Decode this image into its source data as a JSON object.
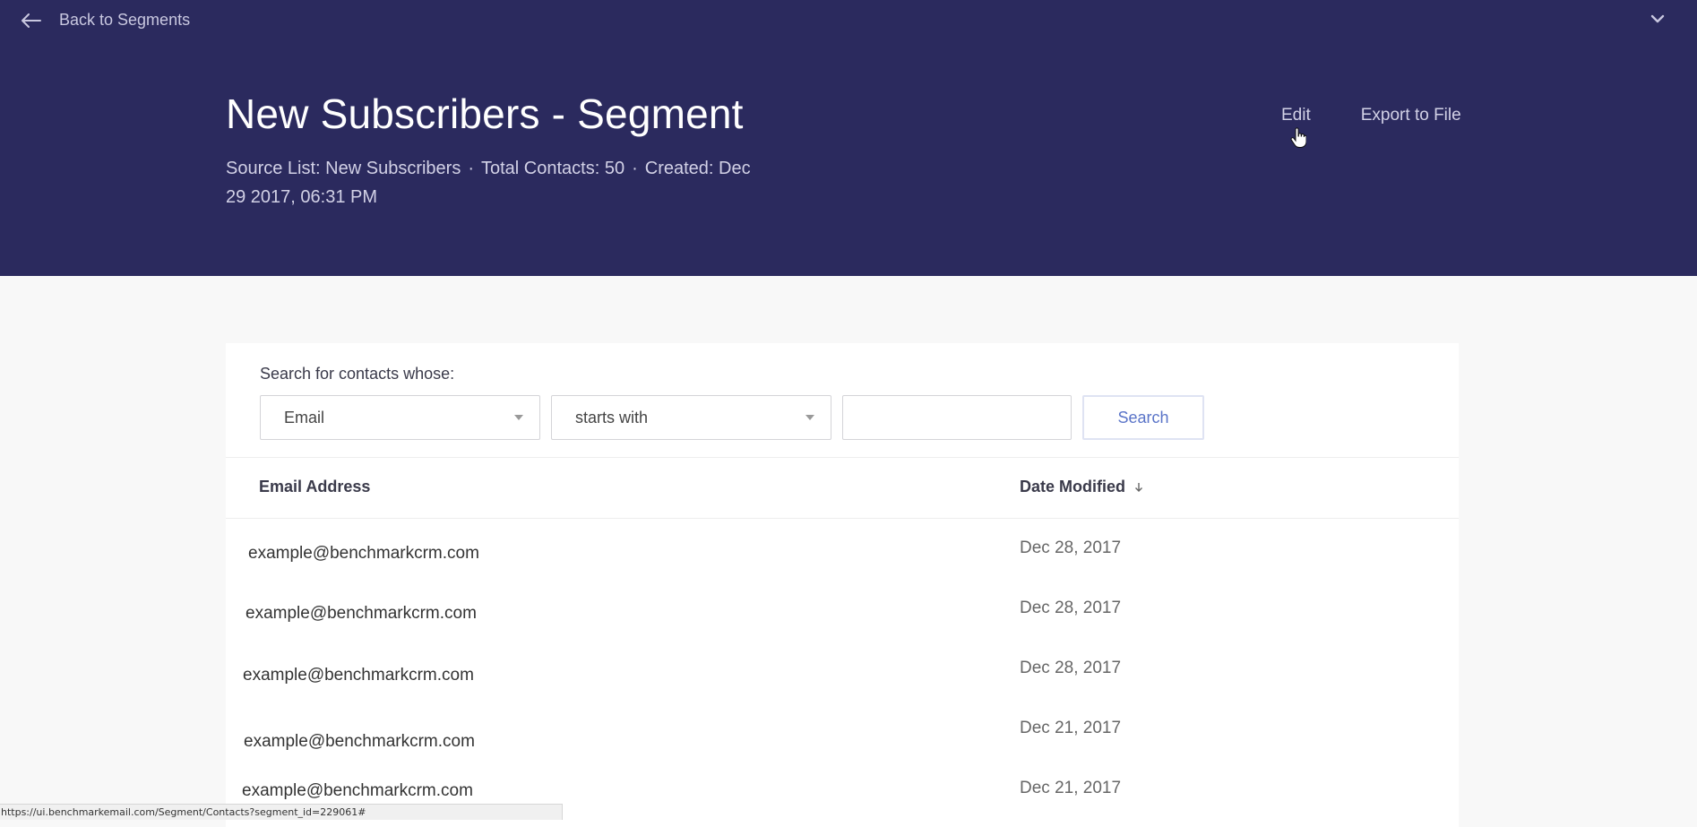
{
  "nav": {
    "back_label": "Back to Segments"
  },
  "segment": {
    "title": "New Subscribers - Segment",
    "source_list": "Source List: New Subscribers",
    "total_contacts": "Total Contacts: 50",
    "created_line1": "Created: Dec",
    "created_line2": "29 2017, 06:31 PM"
  },
  "actions": {
    "edit": "Edit",
    "export": "Export to File"
  },
  "search": {
    "label": "Search for contacts whose:",
    "field_selected": "Email",
    "operator_selected": "starts with",
    "value": "",
    "button": "Search"
  },
  "table": {
    "columns": [
      "Email Address",
      "Date Modified"
    ],
    "rows": [
      {
        "email": "example@benchmarkcrm.com",
        "date": "Dec 28, 2017"
      },
      {
        "email": "example@benchmarkcrm.com",
        "date": "Dec 28, 2017"
      },
      {
        "email": "example@benchmarkcrm.com",
        "date": "Dec 28, 2017"
      },
      {
        "email": "example@benchmarkcrm.com",
        "date": "Dec 21, 2017"
      },
      {
        "email": "example@benchmarkcrm.com",
        "date": "Dec 21, 2017"
      }
    ]
  },
  "status_bar": {
    "url": "https://ui.benchmarkemail.com/Segment/Contacts?segment_id=229061#"
  },
  "colors": {
    "header_bg": "#2b2a5e",
    "accent": "#5a74c8"
  }
}
